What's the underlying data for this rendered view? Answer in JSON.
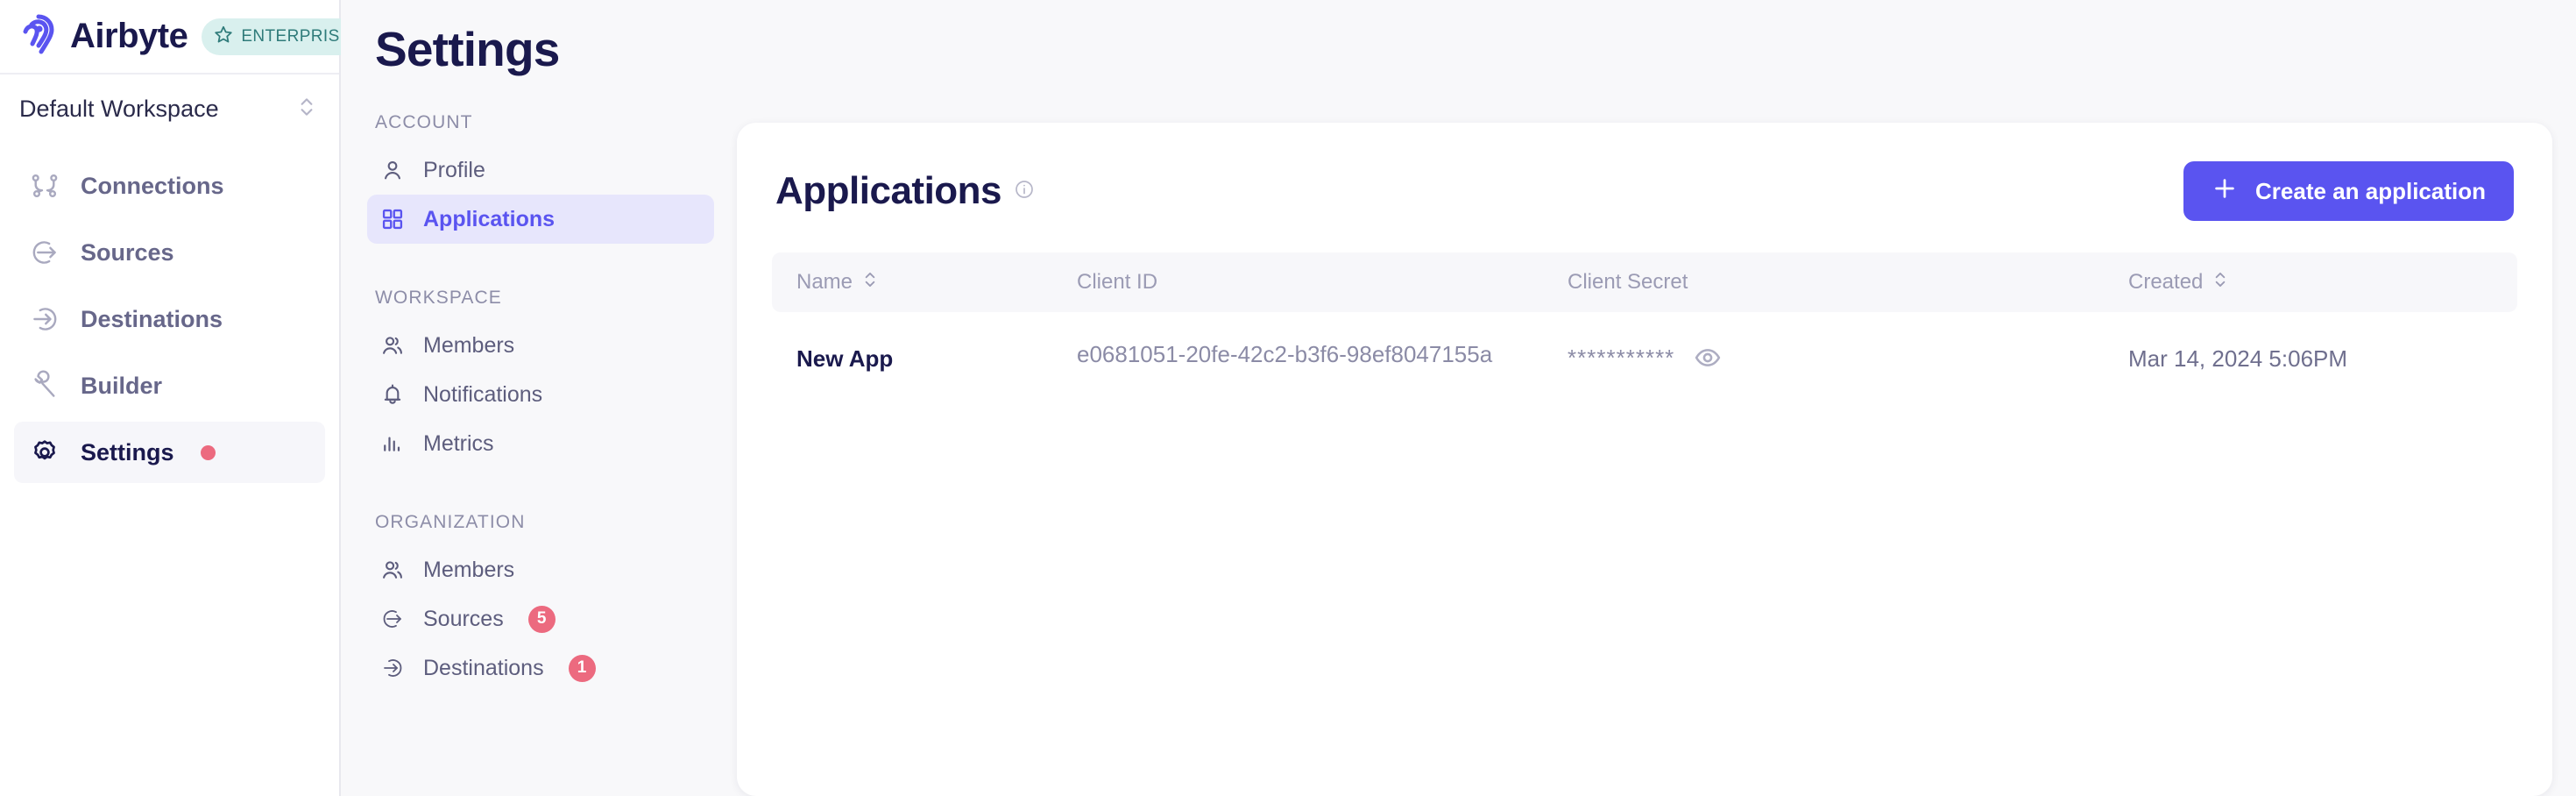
{
  "brand": {
    "wordmark": "Airbyte",
    "plan_badge": "ENTERPRISE",
    "logo_color": "#5a54f0",
    "badge_bg": "#d9f0ee",
    "badge_fg": "#2f7b7a"
  },
  "workspace": {
    "name": "Default Workspace"
  },
  "nav": {
    "items": [
      {
        "label": "Connections",
        "icon": "connections-icon",
        "active": false,
        "dot": false
      },
      {
        "label": "Sources",
        "icon": "source-arrow-icon",
        "active": false,
        "dot": false
      },
      {
        "label": "Destinations",
        "icon": "destination-arrow-icon",
        "active": false,
        "dot": false
      },
      {
        "label": "Builder",
        "icon": "wrench-icon",
        "active": false,
        "dot": false
      },
      {
        "label": "Settings",
        "icon": "gear-icon",
        "active": true,
        "dot": true
      }
    ],
    "dot_color": "#ec6a7f"
  },
  "settings": {
    "page_title": "Settings",
    "groups": [
      {
        "label": "ACCOUNT",
        "items": [
          {
            "label": "Profile",
            "icon": "user-icon",
            "active": false,
            "badge": ""
          },
          {
            "label": "Applications",
            "icon": "grid-icon",
            "active": true,
            "badge": ""
          }
        ]
      },
      {
        "label": "WORKSPACE",
        "items": [
          {
            "label": "Members",
            "icon": "users-icon",
            "active": false,
            "badge": ""
          },
          {
            "label": "Notifications",
            "icon": "bell-icon",
            "active": false,
            "badge": ""
          },
          {
            "label": "Metrics",
            "icon": "bar-chart-icon",
            "active": false,
            "badge": ""
          }
        ]
      },
      {
        "label": "ORGANIZATION",
        "items": [
          {
            "label": "Members",
            "icon": "users-icon",
            "active": false,
            "badge": ""
          },
          {
            "label": "Sources",
            "icon": "source-arrow-icon",
            "active": false,
            "badge": "5"
          },
          {
            "label": "Destinations",
            "icon": "destination-arrow-icon",
            "active": false,
            "badge": "1"
          }
        ]
      }
    ],
    "active_color": "#5a54f0",
    "active_bg": "#e7e6fc"
  },
  "applications": {
    "title": "Applications",
    "info_icon": "info-icon",
    "create_button": "Create an application",
    "create_button_icon": "plus-icon",
    "create_button_color": "#5a54f0",
    "columns": [
      {
        "label": "Name",
        "sortable": true
      },
      {
        "label": "Client ID",
        "sortable": false
      },
      {
        "label": "Client Secret",
        "sortable": false
      },
      {
        "label": "Created",
        "sortable": true
      }
    ],
    "rows": [
      {
        "name": "New App",
        "client_id": "e0681051-20fe-42c2-b3f6-98ef8047155a",
        "client_secret_masked": "***********",
        "reveal_icon": "eye-icon",
        "created": "Mar 14, 2024 5:06PM"
      }
    ]
  }
}
